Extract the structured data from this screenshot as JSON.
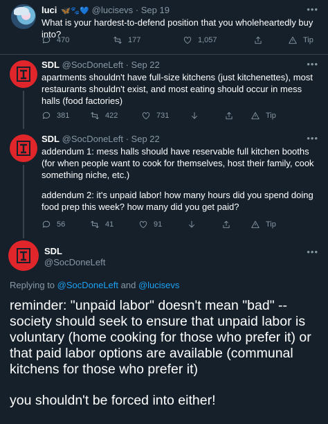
{
  "tweet1": {
    "name": "luci",
    "emojis": "🦋🐾💙",
    "handle": "@lucisevs",
    "time": "Sep 19",
    "text": "What is your hardest-to-defend position that you wholeheartedly buy into?",
    "replies": "470",
    "retweets": "177",
    "likes": "1,057",
    "tip": "Tip"
  },
  "tweet2": {
    "name": "SDL",
    "handle": "@SocDoneLeft",
    "time": "Sep 22",
    "text": "apartments shouldn't have full-size kitchens (just kitchenettes), most restaurants shouldn't exist, and most eating should occur in mess halls (food factories)",
    "replies": "381",
    "retweets": "422",
    "likes": "731",
    "tip": "Tip"
  },
  "tweet3": {
    "name": "SDL",
    "handle": "@SocDoneLeft",
    "time": "Sep 22",
    "text1": "addendum 1: mess halls should have reservable full kitchen booths (for when people want to cook for themselves, host their family, cook something niche, etc.)",
    "text2": "addendum 2: it's unpaid labor! how many hours did you spend doing food prep this week? how many did you get paid?",
    "replies": "56",
    "retweets": "41",
    "likes": "91",
    "tip": "Tip"
  },
  "main": {
    "name": "SDL",
    "handle": "@SocDoneLeft",
    "replying_prefix": "Replying to ",
    "reply_user1": "@SocDoneLeft",
    "reply_and": " and ",
    "reply_user2": "@lucisevs",
    "para1": "reminder: \"unpaid labor\" doesn't mean \"bad\" -- society should seek to ensure that unpaid labor is voluntary (home cooking for those who prefer it) or that paid labor options are available (communal kitchens for those who prefer it)",
    "para2": "you shouldn't be forced into either!"
  },
  "ui": {
    "separator": " · ",
    "more": "•••"
  },
  "colors": {
    "background": "#15202b",
    "secondary_text": "#8899a6",
    "link": "#1da1f2",
    "avatar_red": "#e0262a"
  }
}
